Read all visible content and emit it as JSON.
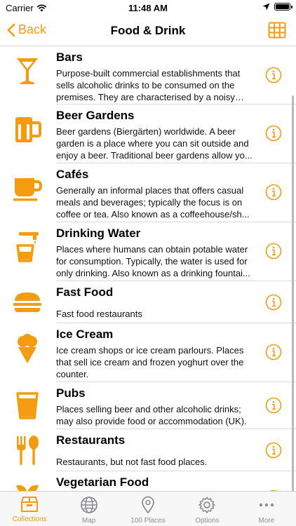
{
  "status": {
    "carrier": "Carrier",
    "time": "11:48 AM",
    "battery_level": 0.95
  },
  "nav": {
    "back_label": "Back",
    "title": "Food & Drink"
  },
  "colors": {
    "accent": "#f39c12",
    "tab_inactive": "#8e8e93"
  },
  "items": [
    {
      "title": "Bars",
      "icon": "cocktail-glass-icon",
      "description": "Purpose-built commercial establishments that sells alcoholic drinks to be consumed on the premises. They are characterised by a noisy an..."
    },
    {
      "title": "Beer Gardens",
      "icon": "beer-mug-icon",
      "description": "Beer gardens (Biergärten) worldwide. A beer garden is a place where you can sit outside and enjoy a beer. Traditional beer gardens allow yo..."
    },
    {
      "title": "Cafés",
      "icon": "coffee-cup-icon",
      "description": "Generally an informal places that offers casual meals and beverages; typically the focus is on coffee or tea. Also known as a coffeehouse/sh..."
    },
    {
      "title": "Drinking Water",
      "icon": "water-tap-icon",
      "description": "Places where humans can obtain potable water for consumption. Typically, the water is used for only drinking. Also known as a drinking fountai..."
    },
    {
      "title": "Fast Food",
      "icon": "burger-icon",
      "description": "Fast food restaurants"
    },
    {
      "title": "Ice Cream",
      "icon": "ice-cream-icon",
      "description": "Ice cream shops or ice cream parlours. Places that sell ice cream and frozen yoghurt over the counter."
    },
    {
      "title": "Pubs",
      "icon": "pint-glass-icon",
      "description": "Places selling beer and other alcoholic drinks; may also provide food or accommodation (UK)."
    },
    {
      "title": "Restaurants",
      "icon": "fork-spoon-icon",
      "description": "Restaurants, but not fast food places."
    },
    {
      "title": "Vegetarian Food",
      "icon": "leaf-icon",
      "description": ""
    }
  ],
  "tabs": [
    {
      "label": "Collections",
      "icon": "collections-box-icon",
      "active": true
    },
    {
      "label": "Map",
      "icon": "globe-icon",
      "active": false
    },
    {
      "label": "100 Places",
      "icon": "location-pin-icon",
      "active": false
    },
    {
      "label": "Options",
      "icon": "gear-icon",
      "active": false
    },
    {
      "label": "More",
      "icon": "more-dots-icon",
      "active": false
    }
  ]
}
